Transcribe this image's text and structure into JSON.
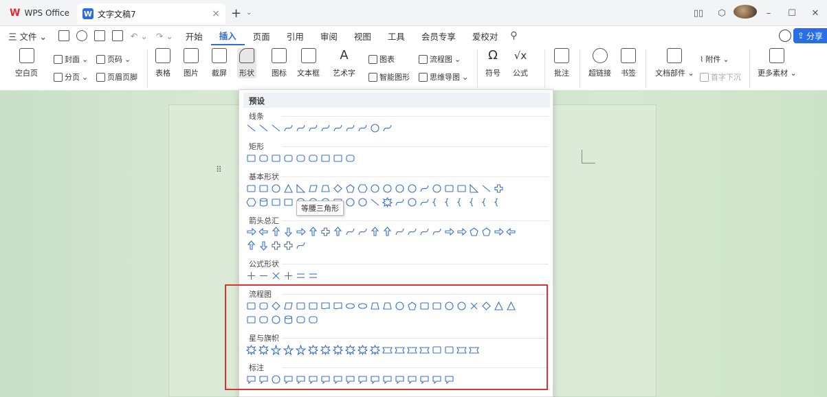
{
  "app": {
    "name": "WPS Office"
  },
  "tab": {
    "title": "文字文稿7"
  },
  "menu": [
    "三 文件 ⌄",
    "开始",
    "插入",
    "页面",
    "引用",
    "审阅",
    "视图",
    "工具",
    "会员专享",
    "爱校对"
  ],
  "share_label": "分享",
  "ribbon": {
    "blank_page": "空白页",
    "cover": "封面",
    "page_break": "分页",
    "page_no": "页码",
    "header_footer": "页眉页脚",
    "table": "表格",
    "image": "图片",
    "screenshot": "截屏",
    "shape": "形状",
    "icon": "图标",
    "textbox": "文本框",
    "wordart": "艺术字",
    "chart": "图表",
    "smartart": "智能图形",
    "flowchart": "流程图",
    "mindmap": "思维导图",
    "symbol": "符号",
    "formula": "公式",
    "comment": "批注",
    "hyperlink": "超链接",
    "bookmark": "书签",
    "docpart": "文档部件",
    "attachment": "附件",
    "dropcap": "首字下沉",
    "more": "更多素材"
  },
  "dropdown": {
    "header": "预设",
    "sections": [
      "线条",
      "矩形",
      "基本形状",
      "箭头总汇",
      "公式形状",
      "流程图",
      "星与旗帜",
      "标注"
    ]
  },
  "tooltip": "等腰三角形",
  "colors": {
    "accent": "#2b6de5",
    "shape_stroke": "#3b6fc5",
    "highlight": "#e03131"
  }
}
